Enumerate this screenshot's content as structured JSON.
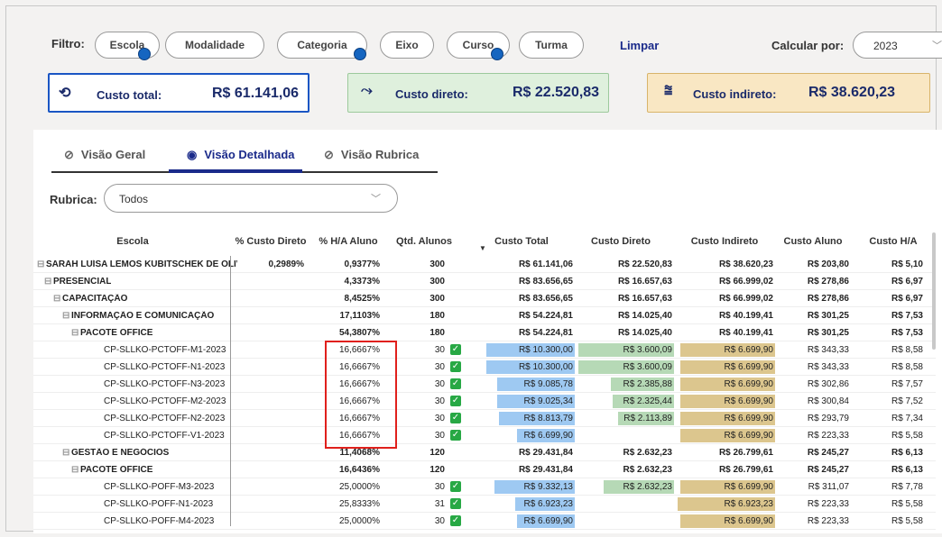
{
  "filters": {
    "label": "Filtro:",
    "pills": [
      "Escola",
      "Modalidade",
      "Categoria",
      "Eixo",
      "Curso",
      "Turma"
    ],
    "clear_label": "Limpar",
    "calc_label": "Calcular por:",
    "year": "2023"
  },
  "cards": {
    "total": {
      "label": "Custo total:",
      "value": "R$ 61.141,06"
    },
    "direto": {
      "label": "Custo direto:",
      "value": "R$ 22.520,83"
    },
    "indireto": {
      "label": "Custo indireto:",
      "value": "R$ 38.620,23"
    }
  },
  "tabs": [
    "Visão Geral",
    "Visão Detalhada",
    "Visão Rubrica"
  ],
  "rubrica": {
    "label": "Rubrica:",
    "value": "Todos"
  },
  "table": {
    "headers": [
      "Escola",
      "% Custo Direto",
      "% H/A Aluno",
      "Qtd. Alunos",
      "Custo Total",
      "Custo Direto",
      "Custo Indireto",
      "Custo Aluno",
      "Custo H/A"
    ],
    "rows": [
      {
        "name": "SARAH LUÍSA LEMOS KUBITSCHEK DE OLIV...",
        "pct_direto": "0,2989%",
        "ha": "0,9377%",
        "qtd": "300",
        "total": "R$ 61.141,06",
        "direto": "R$ 22.520,83",
        "indireto": "R$ 38.620,23",
        "aluno": "R$ 203,80",
        "custo_ha": "R$ 5,10"
      },
      {
        "name": "PRESENCIAL",
        "pct_direto": "",
        "ha": "4,3373%",
        "qtd": "300",
        "total": "R$ 83.656,65",
        "direto": "R$ 16.657,63",
        "indireto": "R$ 66.999,02",
        "aluno": "R$ 278,86",
        "custo_ha": "R$ 6,97"
      },
      {
        "name": "CAPACITAÇÃO",
        "pct_direto": "",
        "ha": "8,4525%",
        "qtd": "300",
        "total": "R$ 83.656,65",
        "direto": "R$ 16.657,63",
        "indireto": "R$ 66.999,02",
        "aluno": "R$ 278,86",
        "custo_ha": "R$ 6,97"
      },
      {
        "name": "INFORMAÇÃO E COMUNICAÇÃO",
        "pct_direto": "",
        "ha": "17,1103%",
        "qtd": "180",
        "total": "R$ 54.224,81",
        "direto": "R$ 14.025,40",
        "indireto": "R$ 40.199,41",
        "aluno": "R$ 301,25",
        "custo_ha": "R$ 7,53"
      },
      {
        "name": "PACOTE OFFICE",
        "pct_direto": "",
        "ha": "54,3807%",
        "qtd": "180",
        "total": "R$ 54.224,81",
        "direto": "R$ 14.025,40",
        "indireto": "R$ 40.199,41",
        "aluno": "R$ 301,25",
        "custo_ha": "R$ 7,53"
      },
      {
        "name": "CP-SLLKO-PCTOFF-M1-2023",
        "pct_direto": "",
        "ha": "16,6667%",
        "qtd": "30",
        "total": "R$ 10.300,00",
        "direto": "R$ 3.600,09",
        "indireto": "R$ 6.699,90",
        "aluno": "R$ 343,33",
        "custo_ha": "R$ 8,58"
      },
      {
        "name": "CP-SLLKO-PCTOFF-N1-2023",
        "pct_direto": "",
        "ha": "16,6667%",
        "qtd": "30",
        "total": "R$ 10.300,00",
        "direto": "R$ 3.600,09",
        "indireto": "R$ 6.699,90",
        "aluno": "R$ 343,33",
        "custo_ha": "R$ 8,58"
      },
      {
        "name": "CP-SLLKO-PCTOFF-N3-2023",
        "pct_direto": "",
        "ha": "16,6667%",
        "qtd": "30",
        "total": "R$ 9.085,78",
        "direto": "R$ 2.385,88",
        "indireto": "R$ 6.699,90",
        "aluno": "R$ 302,86",
        "custo_ha": "R$ 7,57"
      },
      {
        "name": "CP-SLLKO-PCTOFF-M2-2023",
        "pct_direto": "",
        "ha": "16,6667%",
        "qtd": "30",
        "total": "R$ 9.025,34",
        "direto": "R$ 2.325,44",
        "indireto": "R$ 6.699,90",
        "aluno": "R$ 300,84",
        "custo_ha": "R$ 7,52"
      },
      {
        "name": "CP-SLLKO-PCTOFF-N2-2023",
        "pct_direto": "",
        "ha": "16,6667%",
        "qtd": "30",
        "total": "R$ 8.813,79",
        "direto": "R$ 2.113,89",
        "indireto": "R$ 6.699,90",
        "aluno": "R$ 293,79",
        "custo_ha": "R$ 7,34"
      },
      {
        "name": "CP-SLLKO-PCTOFF-V1-2023",
        "pct_direto": "",
        "ha": "16,6667%",
        "qtd": "30",
        "total": "R$ 6.699,90",
        "direto": "",
        "indireto": "R$ 6.699,90",
        "aluno": "R$ 223,33",
        "custo_ha": "R$ 5,58"
      },
      {
        "name": "GESTÃO E NEGÓCIOS",
        "pct_direto": "",
        "ha": "11,4068%",
        "qtd": "120",
        "total": "R$ 29.431,84",
        "direto": "R$ 2.632,23",
        "indireto": "R$ 26.799,61",
        "aluno": "R$ 245,27",
        "custo_ha": "R$ 6,13"
      },
      {
        "name": "PACOTE OFFICE",
        "pct_direto": "",
        "ha": "16,6436%",
        "qtd": "120",
        "total": "R$ 29.431,84",
        "direto": "R$ 2.632,23",
        "indireto": "R$ 26.799,61",
        "aluno": "R$ 245,27",
        "custo_ha": "R$ 6,13"
      },
      {
        "name": "CP-SLLKO-POFF-M3-2023",
        "pct_direto": "",
        "ha": "25,0000%",
        "qtd": "30",
        "total": "R$ 9.332,13",
        "direto": "R$ 2.632,23",
        "indireto": "R$ 6.699,90",
        "aluno": "R$ 311,07",
        "custo_ha": "R$ 7,78"
      },
      {
        "name": "CP-SLLKO-POFF-N1-2023",
        "pct_direto": "",
        "ha": "25,8333%",
        "qtd": "31",
        "total": "R$ 6.923,23",
        "direto": "",
        "indireto": "R$ 6.923,23",
        "aluno": "R$ 223,33",
        "custo_ha": "R$ 5,58"
      },
      {
        "name": "CP-SLLKO-POFF-M4-2023",
        "pct_direto": "",
        "ha": "25,0000%",
        "qtd": "30",
        "total": "R$ 6.699,90",
        "direto": "",
        "indireto": "R$ 6.699,90",
        "aluno": "R$ 223,33",
        "custo_ha": "R$ 5,58"
      }
    ]
  }
}
